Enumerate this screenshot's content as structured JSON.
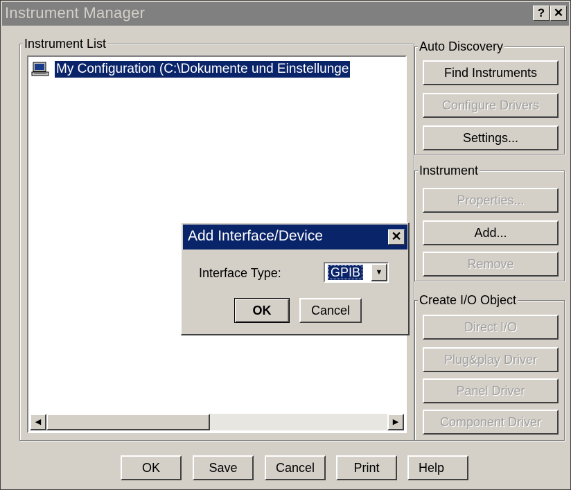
{
  "window": {
    "title": "Instrument Manager",
    "help_glyph": "?",
    "close_glyph": "✕"
  },
  "instrument_list": {
    "legend": "Instrument List",
    "items": [
      {
        "label": "My Configuration (C:\\Dokumente und Einstellunge",
        "icon": "computer-icon",
        "selected": true
      }
    ],
    "scroll_left_glyph": "◀",
    "scroll_right_glyph": "▶"
  },
  "auto_discovery": {
    "legend": "Auto Discovery",
    "buttons": [
      {
        "label": "Find Instruments",
        "enabled": true
      },
      {
        "label": "Configure Drivers",
        "enabled": false
      },
      {
        "label": "Settings...",
        "enabled": true
      }
    ]
  },
  "instrument": {
    "legend": "Instrument",
    "buttons": [
      {
        "label": "Properties...",
        "enabled": false
      },
      {
        "label": "Add...",
        "enabled": true
      },
      {
        "label": "Remove",
        "enabled": false
      }
    ]
  },
  "create_io": {
    "legend": "Create I/O Object",
    "buttons": [
      {
        "label": "Direct I/O",
        "enabled": false
      },
      {
        "label": "Plug&play Driver",
        "enabled": false
      },
      {
        "label": "Panel Driver",
        "enabled": false
      },
      {
        "label": "Component Driver",
        "enabled": false
      }
    ]
  },
  "dialog": {
    "title": "Add Interface/Device",
    "close_glyph": "✕",
    "field_label": "Interface Type:",
    "interface_type": "GPIB",
    "dropdown_glyph": "▼",
    "ok_label": "OK",
    "cancel_label": "Cancel"
  },
  "footer": {
    "buttons": [
      "OK",
      "Save",
      "Cancel",
      "Print",
      "Help"
    ]
  },
  "colors": {
    "face": "#d4d0c8",
    "selection": "#0a246a",
    "inactive_title": "#808080",
    "disabled_text": "#a0a0a0"
  }
}
